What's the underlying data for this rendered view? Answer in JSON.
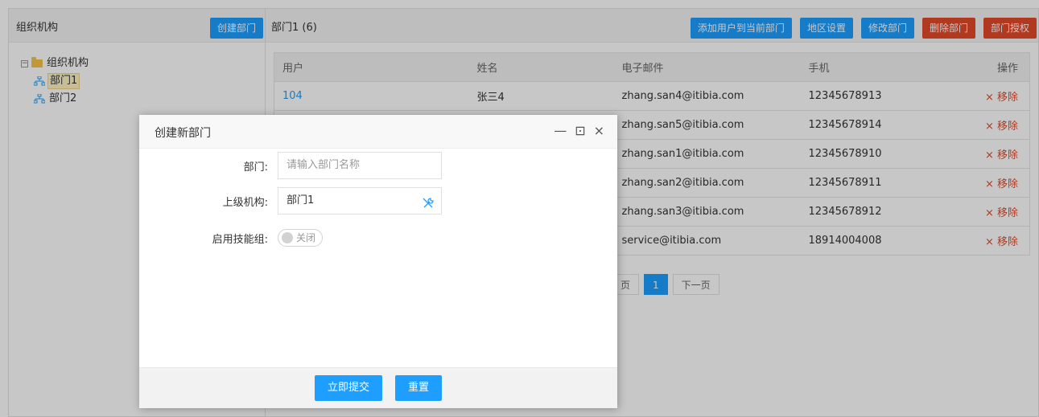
{
  "left": {
    "title": "组织机构",
    "create_button": "创建部门",
    "tree": {
      "root": "组织机构",
      "children": [
        "部门1",
        "部门2"
      ]
    }
  },
  "right": {
    "dept_title": "部门1 (6)",
    "toolbar": {
      "add_user": "添加用户到当前部门",
      "region": "地区设置",
      "edit": "修改部门",
      "delete": "删除部门",
      "auth": "部门授权"
    },
    "table": {
      "headers": [
        "用户",
        "姓名",
        "电子邮件",
        "手机",
        "操作"
      ],
      "rows": [
        {
          "user": "104",
          "name": "张三4",
          "email": "zhang.san4@itibia.com",
          "phone": "12345678913",
          "action": "× 移除"
        },
        {
          "user": "",
          "name": "",
          "email": "zhang.san5@itibia.com",
          "phone": "12345678914",
          "action": "× 移除"
        },
        {
          "user": "",
          "name": "",
          "email": "zhang.san1@itibia.com",
          "phone": "12345678910",
          "action": "× 移除"
        },
        {
          "user": "",
          "name": "",
          "email": "zhang.san2@itibia.com",
          "phone": "12345678911",
          "action": "× 移除"
        },
        {
          "user": "",
          "name": "",
          "email": "zhang.san3@itibia.com",
          "phone": "12345678912",
          "action": "× 移除"
        },
        {
          "user": "",
          "name": "",
          "email": "service@itibia.com",
          "phone": "18914004008",
          "action": "× 移除"
        }
      ]
    },
    "pager": {
      "prev": "页",
      "current": "1",
      "next": "下一页"
    }
  },
  "modal": {
    "title": "创建新部门",
    "controls": {
      "minimize": "—",
      "maximize": "⊡",
      "close": "×"
    },
    "dept_label": "部门:",
    "dept_placeholder": "请输入部门名称",
    "parent_label": "上级机构:",
    "parent_value": "部门1",
    "skill_label": "启用技能组:",
    "skill_switch": "关闭",
    "submit": "立即提交",
    "reset": "重置"
  },
  "colors": {
    "primary": "#1e9fff",
    "danger": "#e34a2a"
  }
}
